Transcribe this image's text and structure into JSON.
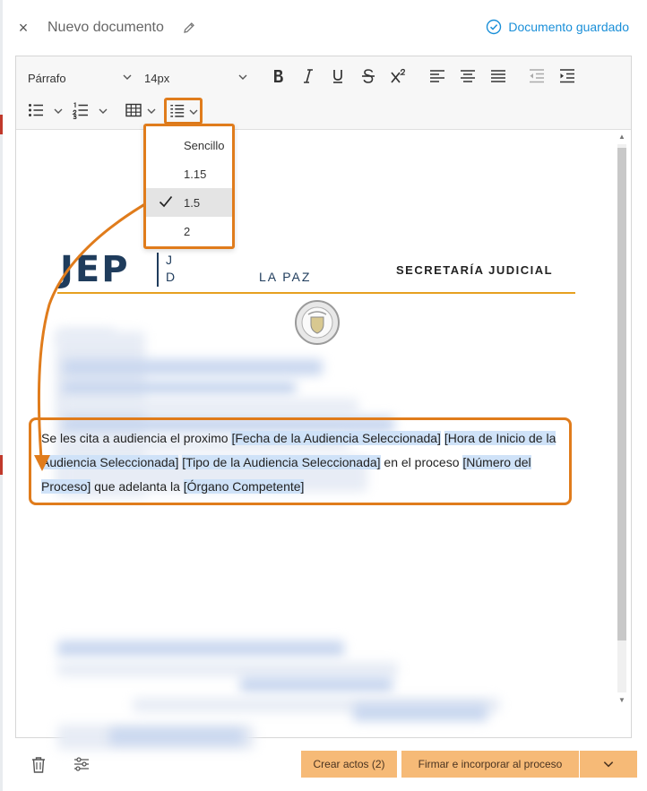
{
  "header": {
    "close_label": "×",
    "title": "Nuevo documento",
    "saved_label": "Documento guardado"
  },
  "toolbar": {
    "paragraph_style": "Párrafo",
    "font_size": "14px"
  },
  "document": {
    "logo_text": "JEP",
    "logo_sub_line1": "J",
    "logo_sub_line2": "D",
    "logo_sub_line2_end": "LA PAZ",
    "secretaria": "SECRETARÍA JUDICIAL",
    "paragraph": {
      "t1": "Se les cita a audiencia el proximo ",
      "f1": "[Fecha de la Audiencia Seleccionada]",
      "t2": " ",
      "f2": "[Hora de Inicio de la Audiencia Seleccionada]",
      "t3": " ",
      "f3": "[Tipo de la Audiencia Seleccionada]",
      "t4": " en el proceso ",
      "f4": "[Número del Proceso]",
      "t5": " que adelanta la ",
      "f5": "[Órgano Competente]"
    }
  },
  "line_spacing_menu": {
    "options": [
      "Sencillo",
      "1.15",
      "1.5",
      "2"
    ],
    "selected": "1.5"
  },
  "footer": {
    "create_acts_label": "Crear actos (2)",
    "sign_label": "Firmar e incorporar al proceso"
  },
  "colors": {
    "accent_orange": "#e07c1c",
    "saved_blue": "#1a8fd8",
    "button_orange": "#f6ba77",
    "highlight_blue": "#cfe2f8",
    "brand_navy": "#1f3c5c",
    "rule_gold": "#e6a020"
  }
}
